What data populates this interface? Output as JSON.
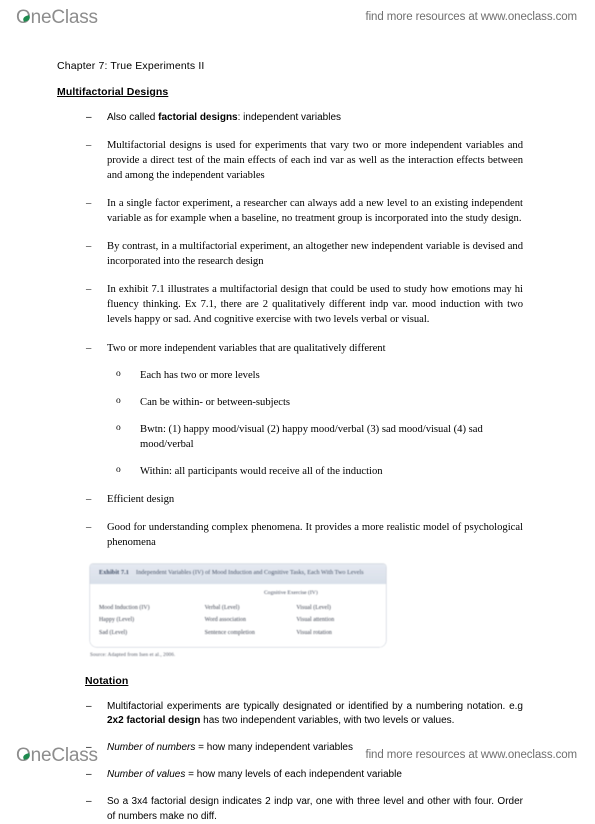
{
  "watermark": {
    "logo_text": "OneClass",
    "tagline": "find more resources at www.oneclass.com"
  },
  "document": {
    "chapter_title": "Chapter 7: True Experiments II",
    "section_heading": "Multifactorial Designs",
    "bullets": [
      {
        "marker": "–",
        "lead_bold": "",
        "text_a": "Also called ",
        "bold": "factorial designs",
        "text_b": ": independent variables"
      },
      {
        "marker": "–",
        "text": "Multifactorial designs is used for experiments that vary two or more independent variables and provide a direct test of the main effects of each ind var as well as the interaction effects between and among the independent variables"
      },
      {
        "marker": "–",
        "text": "In a single factor experiment, a researcher can always add a new level to an existing independent variable as for example when a baseline, no treatment group is incorporated into the study design."
      },
      {
        "marker": "–",
        "text": "By contrast, in a multifactorial experiment, an altogether new independent variable is devised and incorporated into the research design"
      },
      {
        "marker": "–",
        "text": "In exhibit 7.1 illustrates a multifactorial design that could be used to study how emotions may hi fluency thinking. Ex 7.1, there are 2 qualitatively different indp var. mood induction with two levels happy or sad. And cognitive exercise with two levels verbal or visual."
      },
      {
        "marker": "–",
        "text": "Two or more independent variables that are qualitatively different"
      }
    ],
    "sub_bullets": [
      {
        "marker": "o",
        "text": "Each has two or more levels"
      },
      {
        "marker": "o",
        "text": "Can be within- or between-subjects"
      },
      {
        "marker": "o",
        "text": "Bwtn: (1) happy mood/visual (2) happy mood/verbal (3) sad mood/visual (4) sad mood/verbal"
      },
      {
        "marker": "o",
        "text": "Within: all participants would receive all of the induction"
      }
    ],
    "bullets_after": [
      {
        "marker": "–",
        "text": "Efficient design"
      },
      {
        "marker": "–",
        "text": "Good for understanding complex phenomena. It provides a more realistic model of psychological phenomena"
      }
    ],
    "exhibit": {
      "label": "Exhibit 7.1",
      "caption": "Independent Variables (IV) of Mood Induction and Cognitive Tasks, Each With Two Levels",
      "column_header_span": "Cognitive Exercise (IV)",
      "rows": [
        [
          "Mood Induction (IV)",
          "Verbal (Level)",
          "Visual (Level)"
        ],
        [
          "Happy (Level)",
          "Word association",
          "Visual attention"
        ],
        [
          "Sad (Level)",
          "Sentence completion",
          "Visual rotation"
        ]
      ],
      "source": "Source: Adapted from Isen et al., 2006."
    },
    "notation_heading": "Notation",
    "notation_bullets": [
      {
        "marker": "–",
        "text_a": "Multifactorial experiments are typically designated or identified by a numbering notation. e.g ",
        "bold": "2x2  factorial design",
        "text_b": " has two independent variables, with two levels or values."
      },
      {
        "marker": "–",
        "italic": "Number of numbers",
        "text_b": " = how many independent variables"
      },
      {
        "marker": "–",
        "italic": "Number of values",
        "text_b": " = how many levels of each independent variable"
      },
      {
        "marker": "–",
        "text": "So a 3x4 factorial design indicates 2 indp var, one with three level and other with four. Order of numbers make no diff."
      }
    ]
  },
  "colors": {
    "logo_gray": "#8d8d8d",
    "leaf_green": "#1d8a4e",
    "exhibit_header_blue": "#dde3ec"
  }
}
